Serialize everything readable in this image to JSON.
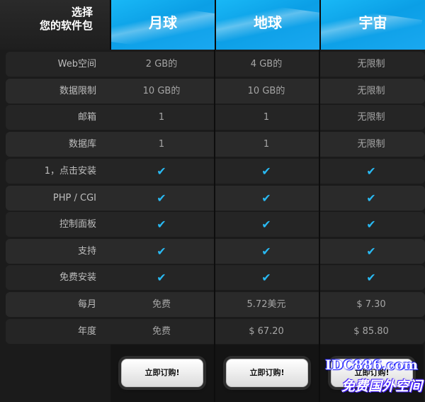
{
  "header": {
    "corner_line1": "选择",
    "corner_line2": "您的软件包",
    "plans": [
      "月球",
      "地球",
      "宇宙"
    ]
  },
  "rows": [
    {
      "label": "Web空间",
      "values": [
        "2 GB的",
        "4 GB的",
        "无限制"
      ]
    },
    {
      "label": "数据限制",
      "values": [
        "10 GB的",
        "10 GB的",
        "无限制"
      ]
    },
    {
      "label": "邮箱",
      "values": [
        "1",
        "1",
        "无限制"
      ]
    },
    {
      "label": "数据库",
      "values": [
        "1",
        "1",
        "无限制"
      ]
    },
    {
      "label": "1，点击安装",
      "values": [
        "✔",
        "✔",
        "✔"
      ]
    },
    {
      "label": "PHP / CGI",
      "values": [
        "✔",
        "✔",
        "✔"
      ]
    },
    {
      "label": "控制面板",
      "values": [
        "✔",
        "✔",
        "✔"
      ]
    },
    {
      "label": "支持",
      "values": [
        "✔",
        "✔",
        "✔"
      ]
    },
    {
      "label": "免费安装",
      "values": [
        "✔",
        "✔",
        "✔"
      ]
    },
    {
      "label": "每月",
      "values": [
        "免费",
        "5.72美元",
        "$ 7.30"
      ]
    },
    {
      "label": "年度",
      "values": [
        "免费",
        "$ 67.20",
        "$ 85.80"
      ]
    }
  ],
  "buttons": {
    "order_label": "立即订购!"
  },
  "watermark": {
    "line1": "IDC886.com",
    "line2": "免费国外空间"
  },
  "colors": {
    "accent": "#19b8f6",
    "check": "#29b9f2",
    "background": "#1b1b1b"
  }
}
